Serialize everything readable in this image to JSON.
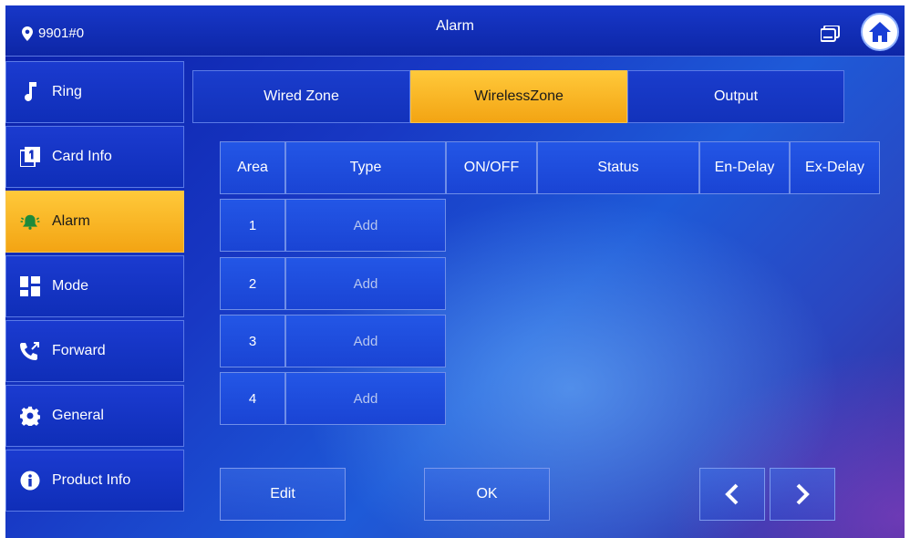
{
  "header": {
    "location": "9901#0",
    "title": "Alarm",
    "icons": [
      "location-pin-icon",
      "device-list-icon",
      "home-icon"
    ]
  },
  "sidebar": {
    "items": [
      {
        "label": "Ring",
        "icon": "music-note-icon",
        "active": false
      },
      {
        "label": "Card Info",
        "icon": "card-icon",
        "active": false
      },
      {
        "label": "Alarm",
        "icon": "alarm-bell-icon",
        "active": true
      },
      {
        "label": "Mode",
        "icon": "grid-icon",
        "active": false
      },
      {
        "label": "Forward",
        "icon": "forward-call-icon",
        "active": false
      },
      {
        "label": "General",
        "icon": "gear-icon",
        "active": false
      },
      {
        "label": "Product Info",
        "icon": "info-icon",
        "active": false
      }
    ]
  },
  "tabs": [
    {
      "label": "Wired Zone",
      "active": false
    },
    {
      "label": "WirelessZone",
      "active": true
    },
    {
      "label": "Output",
      "active": false
    }
  ],
  "table": {
    "headers": [
      "Area",
      "Type",
      "ON/OFF",
      "Status",
      "En-Delay",
      "Ex-Delay"
    ],
    "rows": [
      {
        "area": "1",
        "type": "Add"
      },
      {
        "area": "2",
        "type": "Add"
      },
      {
        "area": "3",
        "type": "Add"
      },
      {
        "area": "4",
        "type": "Add"
      }
    ]
  },
  "footer": {
    "edit_label": "Edit",
    "ok_label": "OK",
    "prev_icon": "chevron-left-icon",
    "next_icon": "chevron-right-icon"
  },
  "colors": {
    "accent": "#f8b825",
    "background": "#1838c4"
  }
}
